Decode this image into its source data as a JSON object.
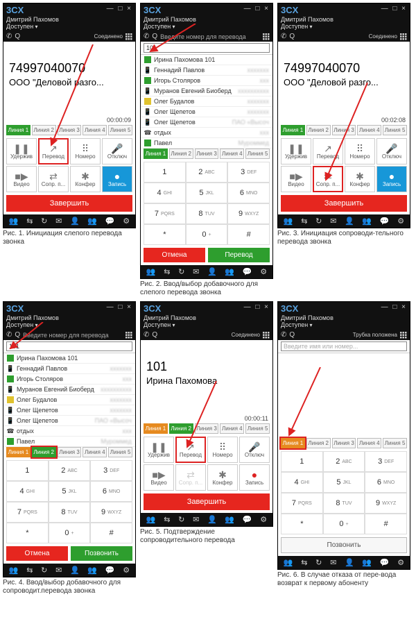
{
  "app": {
    "logo": "3CX",
    "user": "Дмитрий Пахомов",
    "status": "Доступен",
    "win_controls": "—  □  ×"
  },
  "status_line": {
    "connected": "Соединено",
    "transfer_prompt": "Введите номер для перевода",
    "hung_up": "Трубка положена",
    "dial_prompt": "Введите имя или номер..."
  },
  "calls": {
    "a": {
      "number": "74997040070",
      "name": "ООО \"Деловой разго..."
    },
    "b": {
      "number": "101",
      "name": "Ирина Пахомова"
    }
  },
  "timers": {
    "p1": "00:00:09",
    "p3": "00:02:08",
    "p5": "00:00:11"
  },
  "input_101": "101",
  "lines": [
    "Линия 1",
    "Линия 2",
    "Линия 3",
    "Линия 4",
    "Линия 5"
  ],
  "ctrl": {
    "hold": "Удержив",
    "transfer": "Перевод",
    "dialpad": "Номеро",
    "mute": "Отключ",
    "video": "Видео",
    "shuffle": "Сопр. п...",
    "conf": "Конфер",
    "rec": "Запись"
  },
  "end_btn": "Завершить",
  "cancel_btn": "Отмена",
  "transfer_btn": "Перевод",
  "call_btn": "Позвонить",
  "dialpad": [
    [
      "1",
      ""
    ],
    [
      "2",
      "ABC"
    ],
    [
      "3",
      "DEF"
    ],
    [
      "4",
      "GHI"
    ],
    [
      "5",
      "JKL"
    ],
    [
      "6",
      "MNO"
    ],
    [
      "7",
      "PQRS"
    ],
    [
      "8",
      "TUV"
    ],
    [
      "9",
      "WXYZ"
    ],
    [
      "*",
      ""
    ],
    [
      "0",
      "+"
    ],
    [
      "#",
      ""
    ]
  ],
  "contacts": [
    {
      "icon": "sq-g",
      "name": "Ирина Пахомова 101",
      "ext": ""
    },
    {
      "icon": "ph",
      "name": "Геннадий Павлов",
      "ext": "xxxxxxx"
    },
    {
      "icon": "sq-g",
      "name": "Игорь Столяров",
      "ext": "xxx"
    },
    {
      "icon": "ph",
      "name": "Муранов Евгений Биоберд",
      "ext": "xxxxxxxxxx"
    },
    {
      "icon": "sq-y",
      "name": "Олег Будалов",
      "ext": "xxxxxxx"
    },
    {
      "icon": "ph",
      "name": "Олег Щепетов",
      "ext": "xxxxxxx"
    },
    {
      "icon": "ph",
      "name": "Олег Щепетов",
      "ext": "ПАО «Высоч"
    },
    {
      "icon": "tel",
      "name": "отдых",
      "ext": "xxx"
    },
    {
      "icon": "sq-g",
      "name": "Павел",
      "ext": "Муроммед"
    }
  ],
  "captions": {
    "c1": "Рис. 1. Инициация слепого перевода звонка",
    "c2": "Рис. 2. Ввод/выбор добавочного для слепого перевода звонка",
    "c3": "Рис. 3. Инициация сопроводи-тельного перевода звонка",
    "c4": "Рис. 4. Ввод/выбор добавочного для сопроводит.перевода звонка",
    "c5": "Рис. 5. Подтверждение сопроводительного перевода",
    "c6": "Рис. 6. В случае отказа от пере-вода возврат к первому абоненту"
  }
}
